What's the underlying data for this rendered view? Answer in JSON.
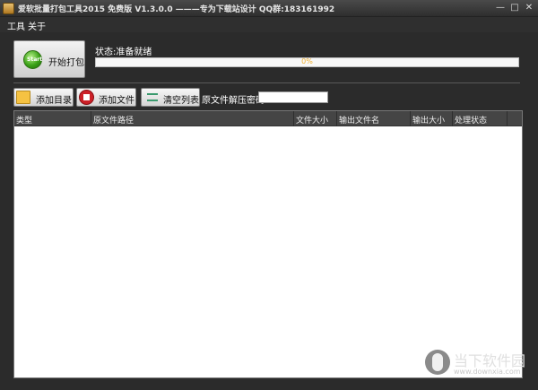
{
  "window": {
    "title": "爱软批量打包工具2015 免费版 V1.3.0.0   ———专为下载站设计 QQ群:183161992",
    "minimize_glyph": "—",
    "maximize_glyph": "□",
    "close_glyph": "✕"
  },
  "menu": {
    "tools": "工具",
    "about": "关于"
  },
  "start": {
    "label": "开始打包",
    "icon_text": "Start",
    "icon": "start-play-icon"
  },
  "status": {
    "text": "状态:准备就绪",
    "progress_text": "0%",
    "progress_value": 0
  },
  "toolbar": {
    "add_dir": "添加目录",
    "add_file": "添加文件",
    "clear_list": "清空列表",
    "password_label": "原文件解压密码",
    "password_value": ""
  },
  "table": {
    "columns": [
      "类型",
      "原文件路径",
      "文件大小",
      "输出文件名",
      "输出大小",
      "处理状态"
    ],
    "rows": []
  },
  "watermark": {
    "title": "当下软件园",
    "url": "www.downxia.com"
  },
  "colors": {
    "background": "#2b2b2b",
    "progress_text": "#f0b030",
    "start_icon": "#3aa117",
    "file_icon": "#cc2027"
  }
}
